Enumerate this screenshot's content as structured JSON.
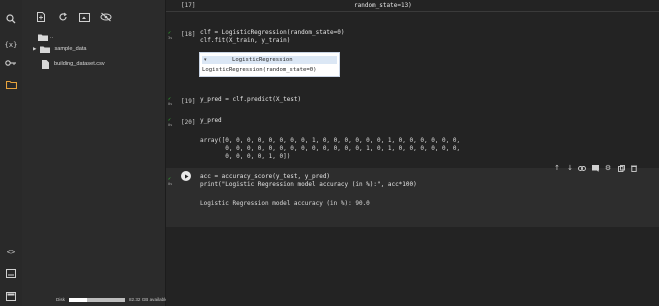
{
  "sidebar": {
    "rail_icons": [
      "search-icon",
      "variables-icon",
      "key-icon",
      "folder-icon",
      "code-snippets-icon",
      "command-palette-icon",
      "terminal-icon"
    ],
    "toolbar_icons": [
      "new-file-icon",
      "new-folder-icon",
      "refresh-icon",
      "upload-icon",
      "hide-icon"
    ],
    "tree": {
      "parent_label": "..",
      "items": [
        {
          "label": "sample_data",
          "type": "folder"
        },
        {
          "label": "building_dataset.csv",
          "type": "file"
        }
      ]
    },
    "disk": {
      "label": "Disk",
      "usage_text": "82.32 GB available",
      "used_fraction": 0.33
    }
  },
  "notebook": {
    "top_line": "random_state=13)",
    "cells": [
      {
        "prompt": "[17]",
        "status": ""
      },
      {
        "prompt": "[18]",
        "status": "3s",
        "code": [
          "clf = LogisticRegression(random_state=0)",
          "clf.fit(X_train, y_train)"
        ]
      },
      {
        "prompt": "[19]",
        "status": "0s",
        "code": [
          "y_pred = clf.predict(X_test)"
        ]
      },
      {
        "prompt": "[20]",
        "status": "0s",
        "code": [
          "y_pred"
        ]
      },
      {
        "prompt": "",
        "status": "0s",
        "code": [
          "acc = accuracy_score(y_test, y_pred)",
          "print(\"Logistic Regression model accuracy (in %):\", acc*100)"
        ]
      }
    ],
    "model_widget": {
      "title": "LogisticRegression",
      "repr": "LogisticRegression(random_state=0)"
    },
    "array_output": [
      "array([0, 0, 0, 0, 0, 0, 0, 0, 1, 0, 0, 0, 0, 0, 0, 1, 0, 0, 0, 0, 0, 0,",
      "       0, 0, 0, 0, 0, 0, 0, 0, 0, 0, 0, 0, 0, 1, 0, 1, 0, 0, 0, 0, 0, 0,",
      "       0, 0, 0, 0, 1, 0])"
    ],
    "print_output": "Logistic Regression model accuracy (in %): 90.0",
    "cell_toolbar_icons": [
      "move-up-icon",
      "move-down-icon",
      "link-icon",
      "comment-icon",
      "settings-icon",
      "mirror-cell-icon",
      "delete-icon"
    ]
  },
  "colors": {
    "app_bg": "#2b2b2b",
    "editor_bg": "#232323",
    "folder_accent": "#e8a33c",
    "success_check": "#30c030"
  }
}
